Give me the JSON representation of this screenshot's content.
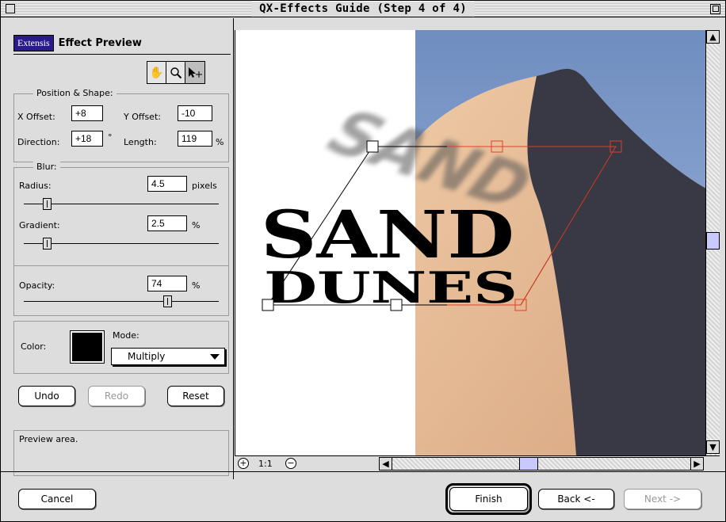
{
  "window": {
    "title": "QX-Effects Guide (Step 4 of 4)"
  },
  "panel": {
    "brand": "Extensis",
    "title": "Effect Preview",
    "tools": [
      "hand-icon",
      "zoom-icon",
      "move-icon"
    ],
    "position_shape": {
      "title": "Position & Shape:",
      "x_offset_label": "X Offset:",
      "x_offset": "+8",
      "y_offset_label": "Y Offset:",
      "y_offset": "-10",
      "direction_label": "Direction:",
      "direction": "+18",
      "degree_symbol": "°",
      "length_label": "Length:",
      "length": "119",
      "length_unit": "%"
    },
    "blur": {
      "title": "Blur:",
      "radius_label": "Radius:",
      "radius": "4.5",
      "radius_unit": "pixels",
      "radius_level": 0.12,
      "gradient_label": "Gradient:",
      "gradient": "2.5",
      "gradient_unit": "%",
      "gradient_level": 0.12
    },
    "opacity": {
      "label": "Opacity:",
      "value": "74",
      "unit": "%",
      "level": 0.74
    },
    "color": {
      "label": "Color:",
      "swatch": "#000000",
      "mode_label": "Mode:",
      "mode": "Multiply"
    },
    "buttons": {
      "undo": "Undo",
      "redo": "Redo",
      "reset": "Reset"
    },
    "status": "Preview area."
  },
  "preview": {
    "headline": "SAND",
    "subline": "DUNES",
    "zoom": "1:1",
    "colors": {
      "sky": "#7f9bc8",
      "sand": "#e3b48f",
      "shadow": "#3a3b46",
      "handle": "#e0402a"
    }
  },
  "footer": {
    "cancel": "Cancel",
    "finish": "Finish",
    "back": "Back <-",
    "next": "Next ->"
  }
}
